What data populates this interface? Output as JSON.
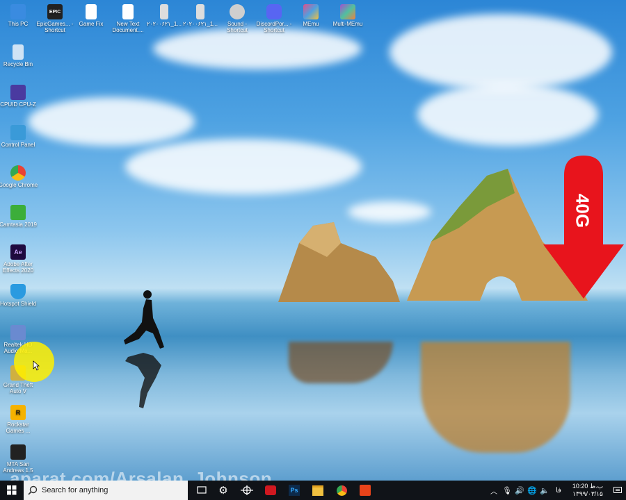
{
  "desktop_icons": [
    {
      "label": "This PC",
      "icon": "monitor-icon",
      "color": "#3a8be0"
    },
    {
      "label": "EpicGames... - Shortcut",
      "icon": "epic-games-icon",
      "color": "#222222",
      "glyph": "EPIC"
    },
    {
      "label": "Game Fix",
      "icon": "file-icon",
      "color": "#ffffff"
    },
    {
      "label": "New Text Document....",
      "icon": "text-document-icon",
      "color": "#ffffff"
    },
    {
      "label": "۲۰۲۰۰۶۲۱_1...",
      "icon": "phone-image-icon",
      "color": "#dddddd"
    },
    {
      "label": "۲۰۲۰۰۶۲۱_1...",
      "icon": "phone-image-icon",
      "color": "#dddddd"
    },
    {
      "label": "Sound - Shortcut",
      "icon": "sound-icon",
      "color": "#cfcfcf"
    },
    {
      "label": "DiscordPor... - Shortcut",
      "icon": "discord-icon",
      "color": "#5865f2"
    },
    {
      "label": "MEmu",
      "icon": "memu-icon",
      "color": "#e0508a"
    },
    {
      "label": "Multi-MEmu",
      "icon": "multi-memu-icon",
      "color": "#a050d0"
    },
    {
      "label": "Recycle Bin",
      "icon": "recycle-bin-icon",
      "color": "#cfe3f5"
    },
    {
      "label": "CPUID CPU-Z",
      "icon": "cpuz-icon",
      "color": "#4a3aa0"
    },
    {
      "label": "Control Panel",
      "icon": "control-panel-icon",
      "color": "#3a9ad8"
    },
    {
      "label": "Google Chrome",
      "icon": "chrome-icon",
      "color": "#e94235"
    },
    {
      "label": "Camtasia 2019",
      "icon": "camtasia-icon",
      "color": "#3cae3a"
    },
    {
      "label": "Adobe After Effects 2020",
      "icon": "after-effects-icon",
      "color": "#1f0a40",
      "glyph": "Ae"
    },
    {
      "label": "Hotspot Shield",
      "icon": "hotspot-shield-icon",
      "color": "#2a9ae0"
    },
    {
      "label": "Realtek HD Audio Ma...",
      "icon": "realtek-audio-icon",
      "color": "#6a8ad0"
    },
    {
      "label": "Grand Theft Auto V",
      "icon": "gta-icon",
      "color": "#d0b040"
    },
    {
      "label": "Rockstar Games ...",
      "icon": "rockstar-icon",
      "color": "#f5b200",
      "glyph": "R"
    },
    {
      "label": "MTA San Andreas 1.5",
      "icon": "mta-icon",
      "color": "#222222"
    }
  ],
  "overlay": {
    "arrow_text": "40G",
    "arrow_color": "#e8141c",
    "watermark": "aparat.com/Arsalan_Johnson"
  },
  "taskbar": {
    "search_placeholder": "Search for anything",
    "pinned": [
      "task-view-icon",
      "settings-icon",
      "network-app-icon",
      "red-app-icon",
      "photoshop-icon",
      "file-explorer-icon",
      "chrome-icon",
      "camtasia-icon"
    ],
    "photoshop_glyph": "Ps",
    "language": "فا",
    "time": "10:20 ب.ظ",
    "date": "۱۳۹۹/۰۳/۱۵",
    "background": "#101318"
  }
}
